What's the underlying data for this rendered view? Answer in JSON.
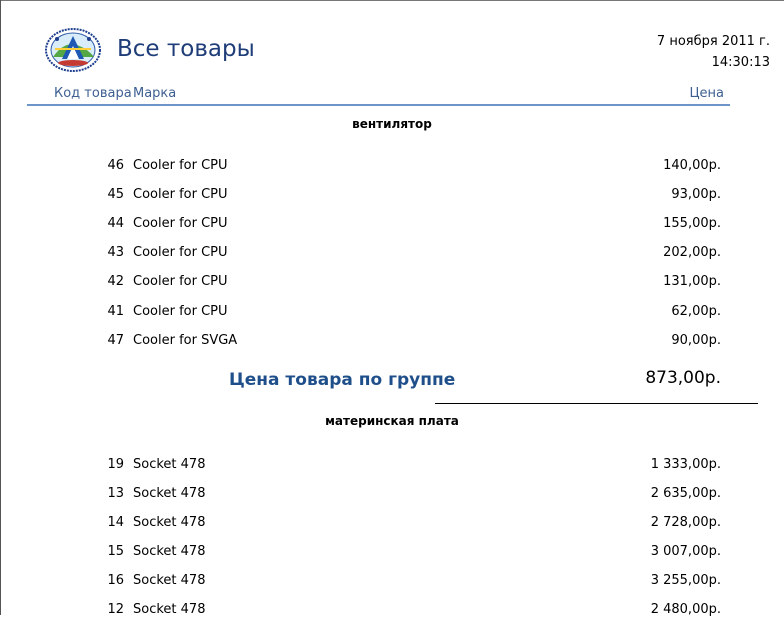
{
  "report": {
    "title": "Все товары",
    "date": "7 ноября 2011 г.",
    "time": "14:30:13"
  },
  "columns": {
    "code": "Код товара",
    "brand": "Марка",
    "price": "Цена"
  },
  "groups": [
    {
      "name": "вентилятор",
      "rows": [
        {
          "code": "46",
          "brand": "Cooler for CPU",
          "price": "140,00р."
        },
        {
          "code": "45",
          "brand": "Cooler for CPU",
          "price": "93,00р."
        },
        {
          "code": "44",
          "brand": "Cooler for CPU",
          "price": "155,00р."
        },
        {
          "code": "43",
          "brand": "Cooler for CPU",
          "price": "202,00р."
        },
        {
          "code": "42",
          "brand": "Cooler for CPU",
          "price": "131,00р."
        },
        {
          "code": "41",
          "brand": "Cooler for CPU",
          "price": "62,00р."
        },
        {
          "code": "47",
          "brand": "Cooler for SVGA",
          "price": "90,00р."
        }
      ],
      "subtotal_label": "Цена товара по группе",
      "subtotal_value": "873,00р."
    },
    {
      "name": "материнская плата",
      "rows": [
        {
          "code": "19",
          "brand": "Socket 478",
          "price": "1 333,00р."
        },
        {
          "code": "13",
          "brand": "Socket 478",
          "price": "2 635,00р."
        },
        {
          "code": "14",
          "brand": "Socket 478",
          "price": "2 728,00р."
        },
        {
          "code": "15",
          "brand": "Socket 478",
          "price": "3 007,00р."
        },
        {
          "code": "16",
          "brand": "Socket 478",
          "price": "3 255,00р."
        },
        {
          "code": "12",
          "brand": "Socket 478",
          "price": "2 480,00р."
        }
      ]
    }
  ]
}
